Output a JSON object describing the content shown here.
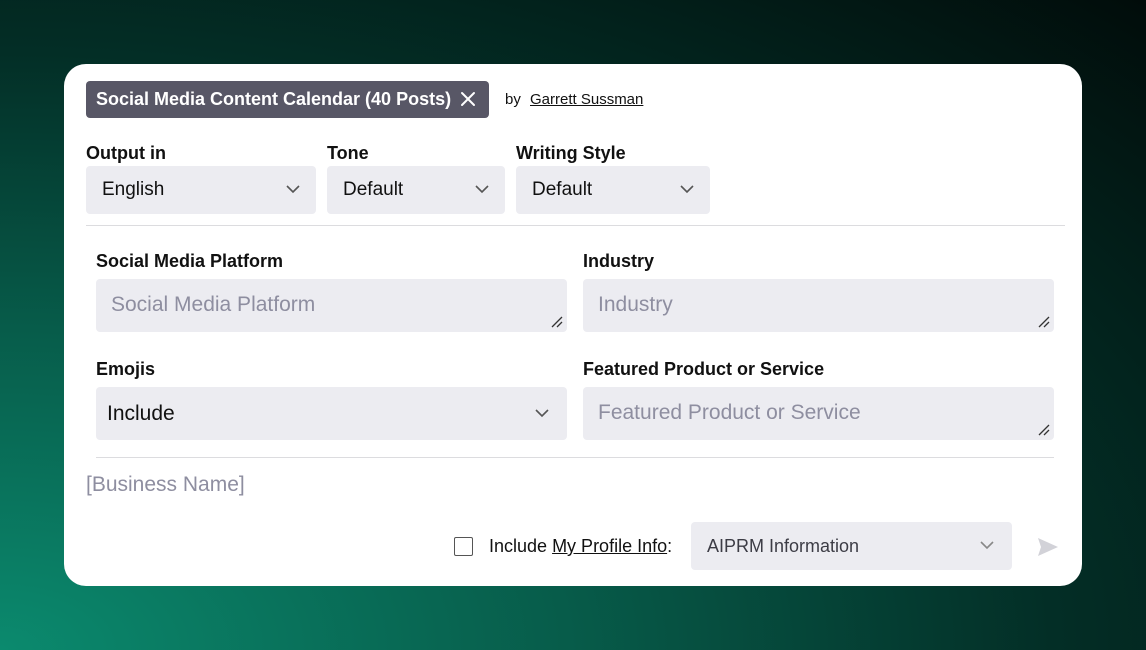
{
  "prompt": {
    "title": "Social Media Content Calendar (40 Posts)",
    "by_label": "by",
    "author": "Garrett Sussman"
  },
  "options": {
    "output_label": "Output in",
    "output_value": "English",
    "tone_label": "Tone",
    "tone_value": "Default",
    "style_label": "Writing Style",
    "style_value": "Default"
  },
  "fields": {
    "platform_label": "Social Media Platform",
    "platform_placeholder": "Social Media Platform",
    "industry_label": "Industry",
    "industry_placeholder": "Industry",
    "emojis_label": "Emojis",
    "emojis_value": "Include",
    "product_label": "Featured Product or Service",
    "product_placeholder": "Featured Product or Service"
  },
  "business_placeholder": "[Business Name]",
  "footer": {
    "include_text": "Include",
    "profile_link": "My Profile Info",
    "colon": ":",
    "profile_select": "AIPRM Information",
    "checkbox_checked": false
  },
  "colors": {
    "tag_bg": "#585766",
    "field_bg": "#ececf1",
    "placeholder": "#8e8ea0"
  }
}
